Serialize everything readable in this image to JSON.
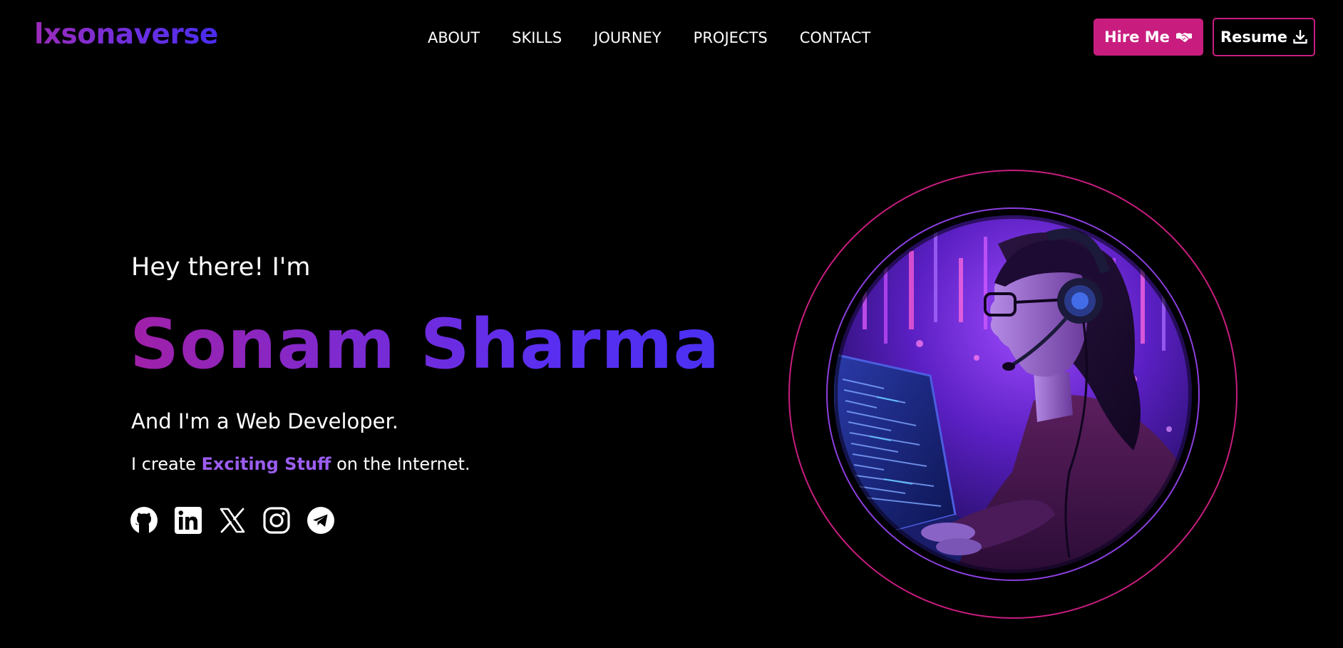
{
  "brand": {
    "logo_text": "lxsonaverse"
  },
  "nav": {
    "links": [
      {
        "label": "ABOUT"
      },
      {
        "label": "SKILLS"
      },
      {
        "label": "JOURNEY"
      },
      {
        "label": "PROJECTS"
      },
      {
        "label": "CONTACT"
      }
    ]
  },
  "actions": {
    "hire_label": "Hire Me",
    "hire_icon": "handshake-icon",
    "resume_label": "Resume",
    "resume_icon": "download-icon"
  },
  "hero": {
    "greeting": "Hey there! I'm",
    "name": "Sonam Sharma",
    "role": "And I'm a Web Developer.",
    "tagline_prefix": "I create",
    "tagline_highlight": "Exciting Stuff",
    "tagline_suffix": "on the Internet.",
    "image_subject": "illustration of a woman with headset and glasses coding at a laptop in neon purple light"
  },
  "socials": [
    {
      "icon": "github-icon"
    },
    {
      "icon": "linkedin-icon"
    },
    {
      "icon": "x-twitter-icon"
    },
    {
      "icon": "instagram-icon"
    },
    {
      "icon": "telegram-icon"
    }
  ],
  "colors": {
    "background": "#000000",
    "primary_pink": "#c81d7f",
    "accent_purple": "#9b5df0",
    "gradient_start": "#a020a8",
    "gradient_end": "#4a30f2",
    "inner_ring": "#8b3fe0"
  }
}
